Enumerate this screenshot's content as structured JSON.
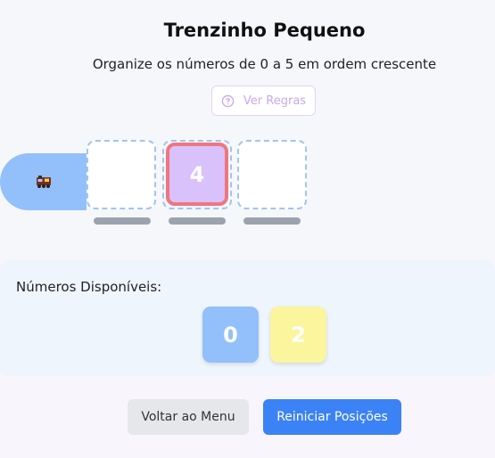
{
  "header": {
    "title": "Trenzinho Pequeno",
    "subtitle": "Organize os números de 0 a 5 em ordem crescente",
    "rules_button": {
      "label": "Ver Regras",
      "icon": "question-circle-icon"
    }
  },
  "train": {
    "engine_icon": "locomotive-icon",
    "engine_color": "#93c0fb",
    "slots": [
      {
        "value": null
      },
      {
        "value": "4",
        "color": "#d9c1fb",
        "border_color": "#ef7680"
      },
      {
        "value": null
      }
    ]
  },
  "available": {
    "label": "Números Disponíveis:",
    "tiles": [
      {
        "value": "0",
        "color": "#93c0fb"
      },
      {
        "value": "2",
        "color": "#fbf59e"
      }
    ]
  },
  "footer": {
    "menu_button": "Voltar ao Menu",
    "reset_button": "Reiniciar Posições",
    "accent": "#3b82f6"
  }
}
